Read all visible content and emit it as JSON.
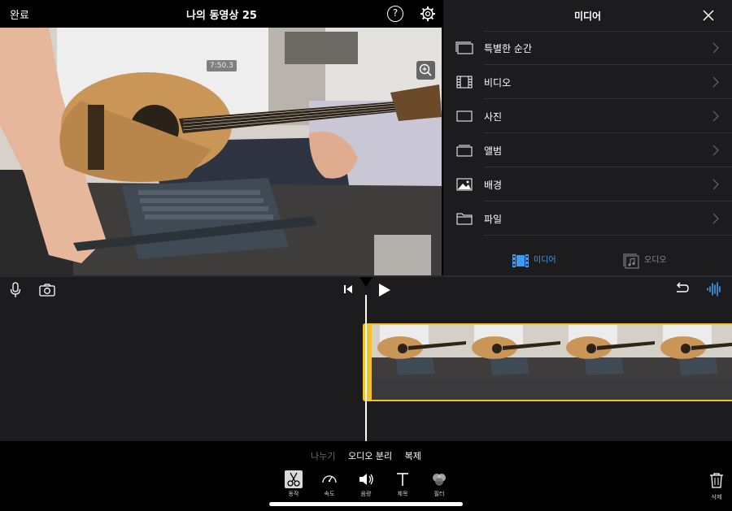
{
  "topbar": {
    "done_label": "완료",
    "project_title": "나의 동영상 25",
    "help_label": "?"
  },
  "viewer": {
    "timecode": "7:50.3"
  },
  "media_panel": {
    "title": "미디어",
    "items": [
      {
        "label": "특별한 순간",
        "icon": "moments-icon"
      },
      {
        "label": "비디오",
        "icon": "film-icon"
      },
      {
        "label": "사진",
        "icon": "photo-icon"
      },
      {
        "label": "앨범",
        "icon": "album-icon"
      },
      {
        "label": "배경",
        "icon": "background-icon"
      },
      {
        "label": "파일",
        "icon": "folder-icon"
      }
    ],
    "tabs": {
      "media_label": "미디어",
      "audio_label": "오디오"
    },
    "accent_color": "#3a9bf4"
  },
  "timeline": {
    "clip_border_color": "#f2c12e"
  },
  "toolbar": {
    "sub_actions": {
      "split": "나누기",
      "detach_audio": "오디오 분리",
      "duplicate": "복제"
    },
    "tools": {
      "actions": "동작",
      "speed": "속도",
      "volume": "음량",
      "titles": "제목",
      "filters": "필터"
    },
    "delete_label": "삭제"
  }
}
